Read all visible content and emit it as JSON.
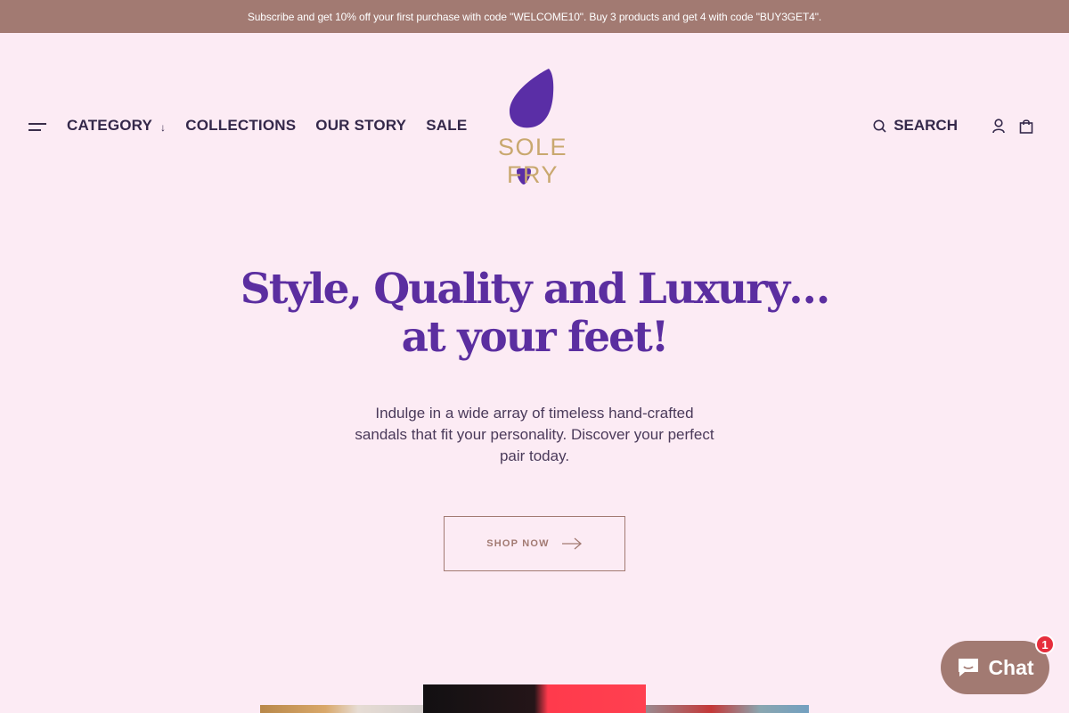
{
  "announcement": {
    "text": "Subscribe and get 10% off your first purchase with code \"WELCOME10\". Buy 3 products and get 4 with code \"BUY3GET4\"."
  },
  "nav": {
    "menu_icon": "hamburger-icon",
    "items": [
      {
        "label": "CATEGORY",
        "has_dropdown": true,
        "arrow": "↓"
      },
      {
        "label": "COLLECTIONS"
      },
      {
        "label": "OUR STORY"
      },
      {
        "label": "SALE"
      }
    ]
  },
  "logo": {
    "text": "SOLE FRY",
    "colors": {
      "drop": "#5a2ea6",
      "text": "#c9a86f"
    }
  },
  "header_right": {
    "search_label": "SEARCH",
    "search_icon": "search-icon",
    "account_icon": "user-icon",
    "cart_icon": "shopping-bag-icon"
  },
  "hero": {
    "title_line1": "Style, Quality and Luxury…",
    "title_line2": "at your feet!",
    "subtitle": "Indulge in a wide array of timeless hand-crafted sandals that fit your personality. Discover your perfect pair today.",
    "cta_label": "SHOP NOW",
    "cta_icon": "arrow-right-icon"
  },
  "chat": {
    "label": "Chat",
    "badge_count": "1",
    "icon": "chat-bubble-icon"
  },
  "colors": {
    "background": "#fcebf4",
    "accent": "#a27a72",
    "title": "#5b2ea0",
    "badge": "#e62e3c"
  }
}
